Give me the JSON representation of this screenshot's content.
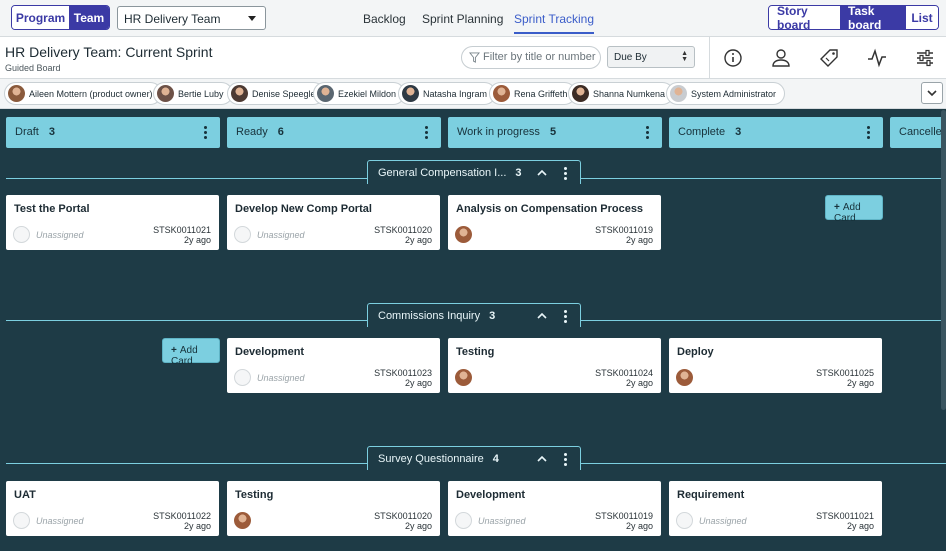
{
  "topbar": {
    "scope_tabs": [
      "Program",
      "Team"
    ],
    "active_scope": "Team",
    "team_dropdown": "HR Delivery Team",
    "nav": [
      "Backlog",
      "Sprint Planning",
      "Sprint Tracking"
    ],
    "active_nav": "Sprint Tracking",
    "view_tabs": [
      "Story board",
      "Task board",
      "List"
    ],
    "active_view": "Task board"
  },
  "header": {
    "title": "HR Delivery Team: Current Sprint",
    "subtitle": "Guided Board",
    "filter_placeholder": "Filter by title or number",
    "sort_value": "Due By",
    "icons": [
      "info-icon",
      "user-icon",
      "tag-icon",
      "activity-icon",
      "settings-sliders-icon"
    ]
  },
  "users": [
    {
      "name": "Aileen Mottern (product owner)",
      "color": "#8a5a3c"
    },
    {
      "name": "Bertie Luby",
      "color": "#6d5147"
    },
    {
      "name": "Denise Speegle",
      "color": "#4d3a33"
    },
    {
      "name": "Ezekiel Mildon",
      "color": "#5a6670"
    },
    {
      "name": "Natasha Ingram",
      "color": "#2f3a44"
    },
    {
      "name": "Rena Griffeth",
      "color": "#9c5b3a"
    },
    {
      "name": "Shanna Numkena",
      "color": "#3d2c25"
    },
    {
      "name": "System Administrator",
      "color": "#c9ccd0"
    }
  ],
  "columns": [
    {
      "name": "Draft",
      "count": "3"
    },
    {
      "name": "Ready",
      "count": "6"
    },
    {
      "name": "Work in progress",
      "count": "5"
    },
    {
      "name": "Complete",
      "count": "3"
    },
    {
      "name": "Cancelled",
      "count": ""
    }
  ],
  "add_card_label": "Add Card",
  "unassigned_label": "Unassigned",
  "lanes": [
    {
      "name": "General Compensation I...",
      "count": "3",
      "cards": [
        {
          "title": "Test the Portal",
          "number": "STSK0011021",
          "age": "2y ago",
          "assigned": false
        },
        {
          "title": "Develop New Comp Portal",
          "number": "STSK0011020",
          "age": "2y ago",
          "assigned": false
        },
        {
          "title": "Analysis on Compensation Process",
          "number": "STSK0011019",
          "age": "2y ago",
          "assigned": true
        }
      ]
    },
    {
      "name": "Commissions Inquiry",
      "count": "3",
      "cards": [
        {
          "title": "Development",
          "number": "STSK0011023",
          "age": "2y ago",
          "assigned": false
        },
        {
          "title": "Testing",
          "number": "STSK0011024",
          "age": "2y ago",
          "assigned": true
        },
        {
          "title": "Deploy",
          "number": "STSK0011025",
          "age": "2y ago",
          "assigned": true
        }
      ]
    },
    {
      "name": "Survey Questionnaire",
      "count": "4",
      "cards": [
        {
          "title": "UAT",
          "number": "STSK0011022",
          "age": "2y ago",
          "assigned": false
        },
        {
          "title": "Testing",
          "number": "STSK0011020",
          "age": "2y ago",
          "assigned": true
        },
        {
          "title": "Development",
          "number": "STSK0011019",
          "age": "2y ago",
          "assigned": false
        },
        {
          "title": "Requirement",
          "number": "STSK0011021",
          "age": "2y ago",
          "assigned": false
        }
      ]
    }
  ]
}
